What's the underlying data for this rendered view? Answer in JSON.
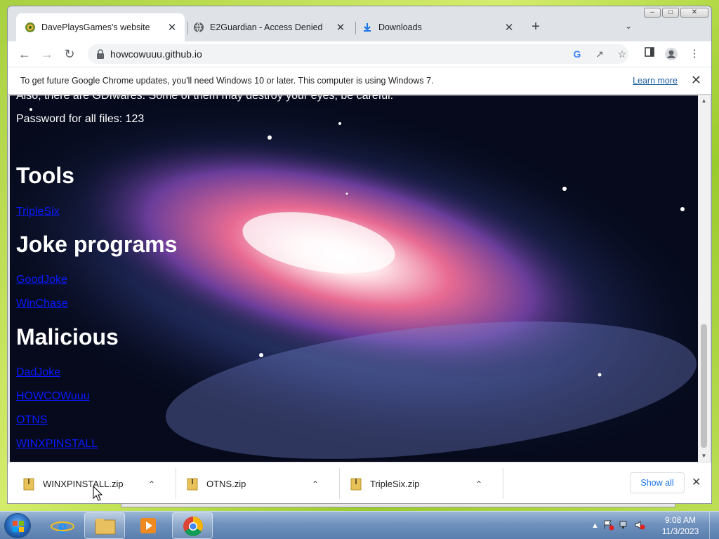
{
  "browser": {
    "tabs": [
      {
        "title": "DavePlaysGames's website",
        "icon": "site-favicon",
        "active": true
      },
      {
        "title": "E2Guardian - Access Denied",
        "icon": "globe-icon",
        "active": false
      },
      {
        "title": "Downloads",
        "icon": "download-icon",
        "active": false
      }
    ],
    "url": "howcowuuu.github.io",
    "infobar": {
      "message": "To get future Google Chrome updates, you'll need Windows 10 or later. This computer is using Windows 7.",
      "link": "Learn more"
    }
  },
  "page": {
    "cut_text": "Also, there are GDIwares. Some of them may destroy your eyes, be careful.",
    "password": "Password for all files: 123",
    "sections": [
      {
        "heading": "Tools",
        "links": [
          "TripleSix"
        ]
      },
      {
        "heading": "Joke programs",
        "links": [
          "GoodJoke",
          "WinChase"
        ]
      },
      {
        "heading": "Malicious",
        "links": [
          "DadJoke",
          "HOWCOWuuu",
          "OTNS",
          "WINXPINSTALL"
        ]
      }
    ]
  },
  "downloads": {
    "items": [
      "WINXPINSTALL.zip",
      "OTNS.zip",
      "TripleSix.zip"
    ],
    "show_all": "Show all"
  },
  "taskbar": {
    "time": "9:08 AM",
    "date": "11/3/2023",
    "pinned": [
      "internet-explorer",
      "windows-explorer",
      "media-player",
      "chrome"
    ]
  },
  "colors": {
    "link": "#0a1aff",
    "accent": "#1a73e8"
  }
}
